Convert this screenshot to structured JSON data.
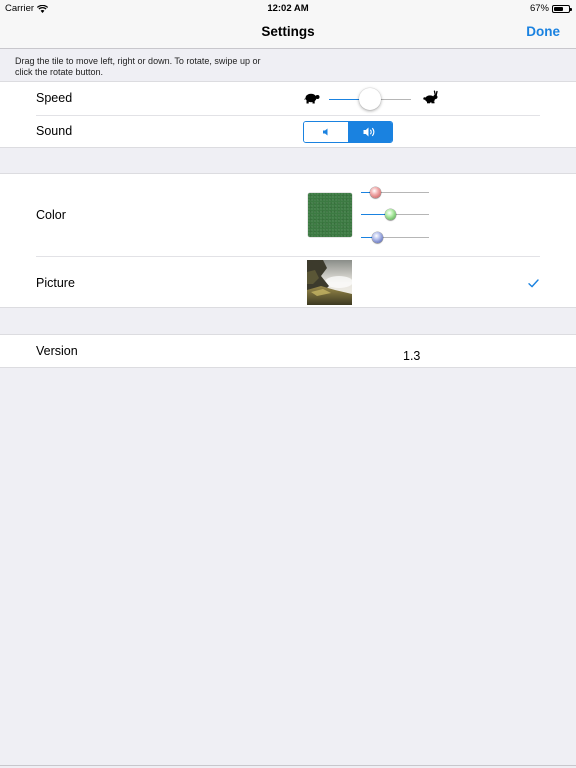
{
  "status_bar": {
    "carrier": "Carrier",
    "time": "12:02 AM",
    "battery_percent": "67%",
    "battery_level": 0.67,
    "wifi_icon": "wifi-icon",
    "battery_icon": "battery-icon"
  },
  "nav": {
    "title": "Settings",
    "done_label": "Done"
  },
  "hint": "Drag the tile to move left, right or down. To rotate, swipe up or click the rotate button.",
  "settings": {
    "speed": {
      "label": "Speed",
      "slow_icon": "turtle-icon",
      "fast_icon": "rabbit-icon",
      "value": 0.5
    },
    "sound": {
      "label": "Sound",
      "options": [
        "speaker-off-icon",
        "speaker-on-icon"
      ],
      "selected_index": 1
    },
    "color": {
      "label": "Color",
      "swatch_color": "#3c7a42",
      "red": 0.2,
      "green": 0.42,
      "blue": 0.24
    },
    "picture": {
      "label": "Picture",
      "selected": true
    },
    "version": {
      "label": "Version",
      "value": "1.3"
    }
  },
  "colors": {
    "accent": "#1a82e0",
    "background": "#efeff4"
  }
}
